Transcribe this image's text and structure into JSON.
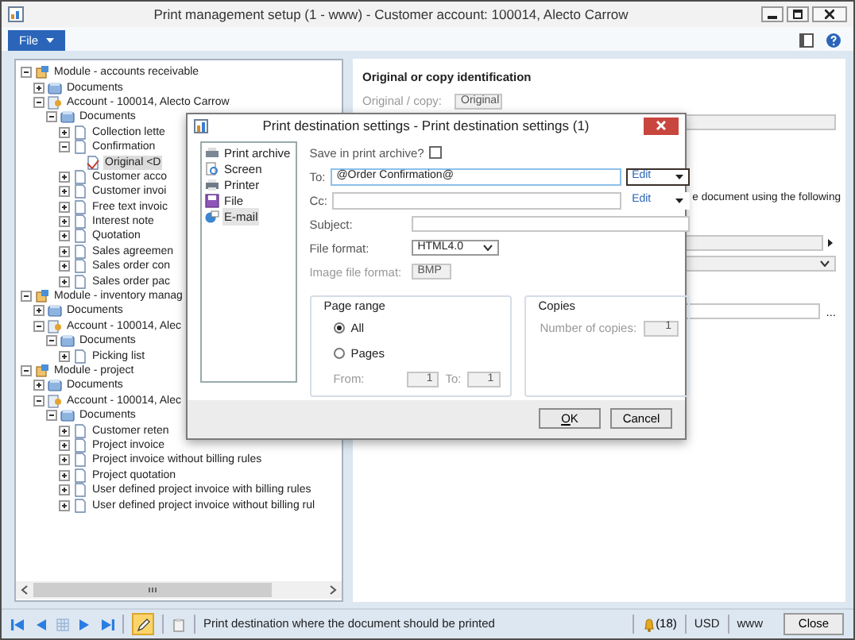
{
  "window": {
    "title": "Print management setup (1 - www) - Customer account: 100014, Alecto Carrow"
  },
  "menu": {
    "file_label": "File"
  },
  "tree": {
    "items": [
      {
        "label": "Module - accounts receivable",
        "kind": "module",
        "expanded": true,
        "selected": false,
        "children": [
          {
            "label": "Documents",
            "kind": "folder",
            "expanded": false,
            "selected": false
          },
          {
            "label": "Account - 100014, Alecto Carrow",
            "kind": "account",
            "expanded": true,
            "selected": false,
            "children": [
              {
                "label": "Documents",
                "kind": "folder",
                "expanded": true,
                "selected": false,
                "children": [
                  {
                    "label": "Collection lette",
                    "kind": "document",
                    "expanded": false,
                    "selected": false
                  },
                  {
                    "label": "Confirmation",
                    "kind": "document",
                    "expanded": true,
                    "selected": false,
                    "children": [
                      {
                        "label": "Original <D",
                        "kind": "original",
                        "selected": true
                      }
                    ]
                  },
                  {
                    "label": "Customer acco",
                    "kind": "document",
                    "expanded": false,
                    "selected": false
                  },
                  {
                    "label": "Customer invoi",
                    "kind": "document",
                    "expanded": false,
                    "selected": false
                  },
                  {
                    "label": "Free text invoic",
                    "kind": "document",
                    "expanded": false,
                    "selected": false
                  },
                  {
                    "label": "Interest note",
                    "kind": "document",
                    "expanded": false,
                    "selected": false
                  },
                  {
                    "label": "Quotation",
                    "kind": "document",
                    "expanded": false,
                    "selected": false
                  },
                  {
                    "label": "Sales agreemen",
                    "kind": "document",
                    "expanded": false,
                    "selected": false
                  },
                  {
                    "label": "Sales order con",
                    "kind": "document",
                    "expanded": false,
                    "selected": false
                  },
                  {
                    "label": "Sales order pac",
                    "kind": "document",
                    "expanded": false,
                    "selected": false
                  }
                ]
              }
            ]
          }
        ]
      },
      {
        "label": "Module - inventory manag",
        "kind": "module",
        "expanded": true,
        "selected": false,
        "children": [
          {
            "label": "Documents",
            "kind": "folder",
            "expanded": false,
            "selected": false
          },
          {
            "label": "Account - 100014, Alec",
            "kind": "account",
            "expanded": true,
            "selected": false,
            "children": [
              {
                "label": "Documents",
                "kind": "folder",
                "expanded": true,
                "selected": false,
                "children": [
                  {
                    "label": "Picking list",
                    "kind": "document",
                    "expanded": false,
                    "selected": false
                  }
                ]
              }
            ]
          }
        ]
      },
      {
        "label": "Module - project",
        "kind": "module",
        "expanded": true,
        "selected": false,
        "children": [
          {
            "label": "Documents",
            "kind": "folder",
            "expanded": false,
            "selected": false
          },
          {
            "label": "Account - 100014, Alec",
            "kind": "account",
            "expanded": true,
            "selected": false,
            "children": [
              {
                "label": "Documents",
                "kind": "folder",
                "expanded": true,
                "selected": false,
                "children": [
                  {
                    "label": "Customer reten",
                    "kind": "document",
                    "expanded": false,
                    "selected": false
                  },
                  {
                    "label": "Project invoice",
                    "kind": "document",
                    "expanded": false,
                    "selected": false
                  },
                  {
                    "label": "Project invoice without billing rules",
                    "kind": "document",
                    "expanded": false,
                    "selected": false
                  },
                  {
                    "label": "Project quotation",
                    "kind": "document",
                    "expanded": false,
                    "selected": false
                  },
                  {
                    "label": "User defined project invoice with billing rules",
                    "kind": "document",
                    "expanded": false,
                    "selected": false
                  },
                  {
                    "label": "User defined project invoice without billing rul",
                    "kind": "document",
                    "expanded": false,
                    "selected": false
                  }
                ]
              }
            ]
          }
        ]
      }
    ]
  },
  "details": {
    "heading": "Original or copy identification",
    "original_copy": {
      "label": "Original / copy:",
      "value": "Original",
      "disabled": true
    },
    "partial_text": "e document using the following",
    "browse_button": "..."
  },
  "dialog": {
    "title": "Print destination settings - Print destination settings (1)",
    "destinations": [
      {
        "label": "Print archive",
        "kind": "archive",
        "selected": false
      },
      {
        "label": "Screen",
        "kind": "screen",
        "selected": false
      },
      {
        "label": "Printer",
        "kind": "printer",
        "selected": false
      },
      {
        "label": "File",
        "kind": "file",
        "selected": false
      },
      {
        "label": "E-mail",
        "kind": "email",
        "selected": true
      }
    ],
    "save_archive": {
      "label": "Save in print archive?",
      "checked": false
    },
    "to": {
      "label": "To:",
      "value": "@Order Confirmation@",
      "edit": "Edit"
    },
    "cc": {
      "label": "Cc:",
      "edit": "Edit"
    },
    "subject": {
      "label": "Subject:"
    },
    "file_format": {
      "label": "File format:",
      "value": "HTML4.0"
    },
    "image_format": {
      "label": "Image file format:",
      "value": "BMP",
      "disabled": true
    },
    "page_range": {
      "title": "Page range",
      "options": [
        {
          "label": "All",
          "selected": true
        },
        {
          "label": "Pages",
          "selected": false
        }
      ],
      "from_label": "From:",
      "from_value": "1",
      "to_label": "To:",
      "to_value": "1"
    },
    "copies": {
      "title": "Copies",
      "label": "Number of copies:",
      "value": "1"
    },
    "buttons": [
      "OK",
      "Cancel"
    ]
  },
  "status_bar": {
    "edit_mode": true,
    "message": "Print destination where the document should be printed",
    "notifications": "(18)",
    "currency": "USD",
    "company": "www",
    "close": "Close"
  }
}
